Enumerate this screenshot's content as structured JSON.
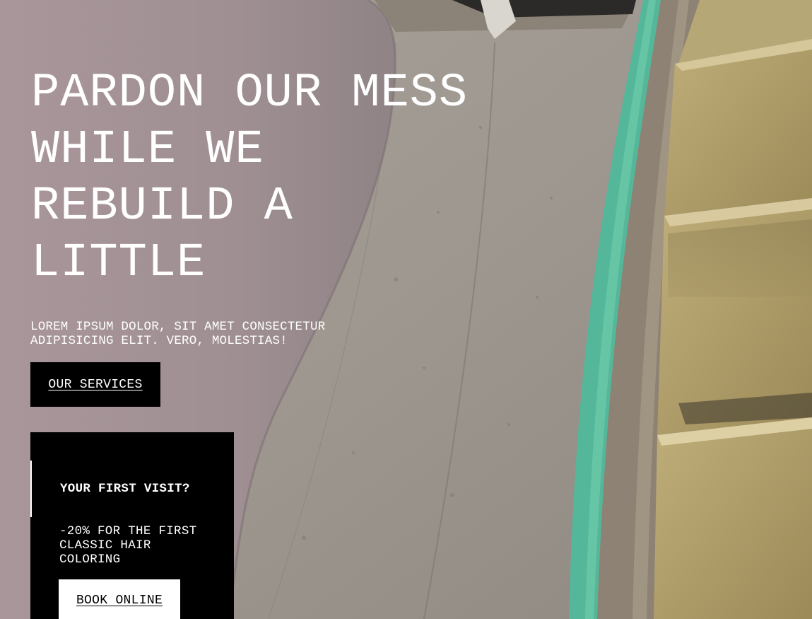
{
  "hero": {
    "title": "PARDON OUR MESS WHILE WE REBUILD A LITTLE",
    "subtitle": "LOREM IPSUM DOLOR, SIT AMET CONSECTETUR ADIPISICING ELIT. VERO, MOLESTIAS!",
    "services_button": "OUR SERVICES"
  },
  "promo": {
    "title": "YOUR FIRST VISIT?",
    "text": "-20% FOR THE FIRST CLASSIC HAIR COLORING",
    "book_button": "BOOK ONLINE"
  }
}
